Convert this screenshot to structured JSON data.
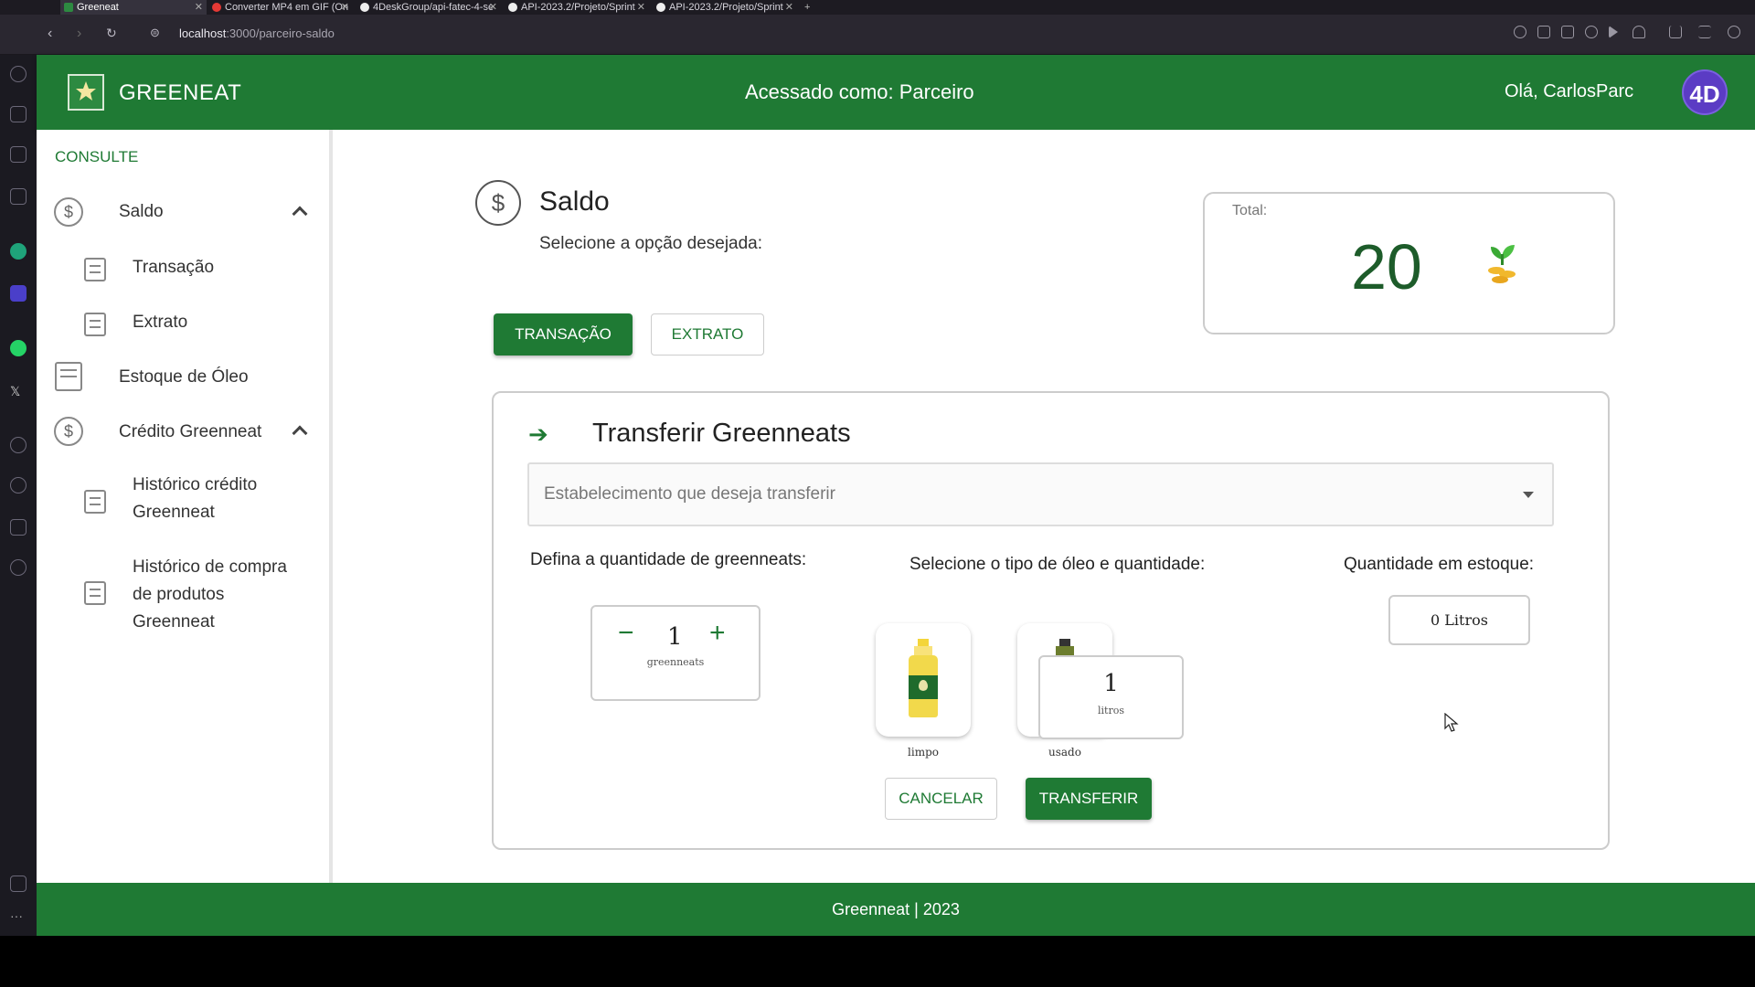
{
  "browser": {
    "tabs": [
      {
        "title": "Greeneat",
        "active": true
      },
      {
        "title": "Converter MP4 em GIF (On",
        "active": false
      },
      {
        "title": "4DeskGroup/api-fatec-4-se",
        "active": false
      },
      {
        "title": "API-2023.2/Projeto/Sprint",
        "active": false
      },
      {
        "title": "API-2023.2/Projeto/Sprint",
        "active": false
      }
    ],
    "url_host": "localhost",
    "url_path": ":3000/parceiro-saldo"
  },
  "header": {
    "brand": "GREENEAT",
    "accessed_as": "Acessado como: Parceiro",
    "greeting": "Olá, CarlosParc",
    "avatar_text": "4D"
  },
  "sidebar": {
    "section_label": "CONSULTE",
    "items": [
      {
        "label": "Saldo"
      },
      {
        "label": "Transação"
      },
      {
        "label": "Extrato"
      },
      {
        "label": "Estoque de Óleo"
      },
      {
        "label": "Crédito Greenneat"
      },
      {
        "label_line1": "Histórico crédito",
        "label_line2": "Greenneat"
      },
      {
        "label_line1": "Histórico de compra",
        "label_line2": "de produtos",
        "label_line3": "Greenneat"
      }
    ]
  },
  "saldo": {
    "icon": "dollar-circle-icon",
    "title": "Saldo",
    "subtitle": "Selecione a opção desejada:",
    "btn_transaction": "TRANSAÇÃO",
    "btn_statement": "EXTRATO"
  },
  "total": {
    "label": "Total:",
    "value": "20"
  },
  "transfer": {
    "title": "Transferir Greenneats",
    "select_placeholder": "Estabelecimento que deseja transferir",
    "qty_label": "Defina a quantidade de greenneats:",
    "oil_label": "Selecione o tipo de óleo e quantidade:",
    "stock_label": "Quantidade em estoque:",
    "qty_value": "1",
    "qty_unit": "greenneats",
    "oil_types": [
      {
        "label": "limpo",
        "color": "#f2d94b"
      },
      {
        "label": "usado",
        "color": "#4f6b23"
      }
    ],
    "liters_value": "1",
    "liters_unit": "litros",
    "stock_value": "0 Litros",
    "btn_cancel": "CANCELAR",
    "btn_transfer": "TRANSFERIR"
  },
  "footer": {
    "text": "Greenneat | 2023"
  },
  "colors": {
    "brand_green": "#1f7a34"
  }
}
